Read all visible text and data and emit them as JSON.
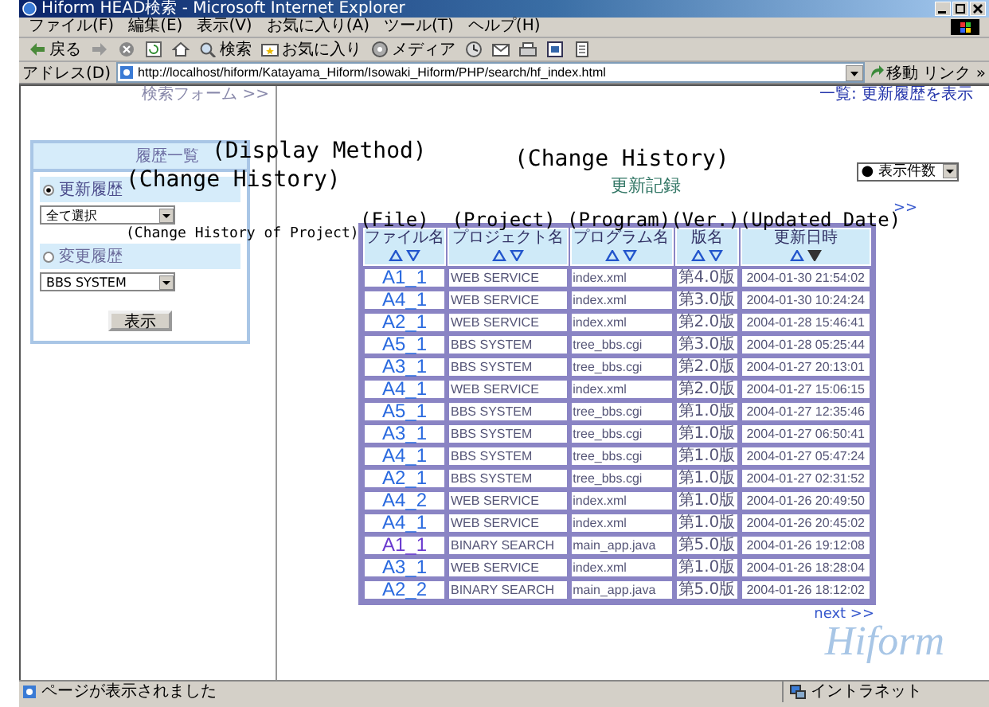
{
  "window": {
    "title": "Hiform HEAD検索 - Microsoft Internet Explorer"
  },
  "menu": [
    "ファイル(F)",
    "編集(E)",
    "表示(V)",
    "お気に入り(A)",
    "ツール(T)",
    "ヘルプ(H)"
  ],
  "toolbar": [
    {
      "kind": "back",
      "label": "戻る"
    },
    {
      "kind": "forward"
    },
    {
      "kind": "stop"
    },
    {
      "kind": "refresh"
    },
    {
      "kind": "home"
    },
    {
      "kind": "search",
      "label": "検索"
    },
    {
      "kind": "favorites",
      "label": "お気に入り"
    },
    {
      "kind": "media",
      "label": "メディア"
    },
    {
      "kind": "history"
    },
    {
      "kind": "mail"
    },
    {
      "kind": "print"
    },
    {
      "kind": "edit"
    },
    {
      "kind": "discuss"
    }
  ],
  "address": {
    "label": "アドレス(D)",
    "url": "http://localhost/hiform/Katayama_Hiform/Isowaki_Hiform/PHP/search/hf_index.html",
    "go": "移動",
    "links": "リンク »"
  },
  "left_frame": {
    "search_form_link": "検索フォーム >>",
    "panel_title": "履歴一覧",
    "options": [
      {
        "label": "更新履歴",
        "selected": true,
        "select": "全て選択"
      },
      {
        "label": "変更履歴",
        "selected": false,
        "select": "BBS SYSTEM"
      }
    ],
    "button": "表示"
  },
  "right_frame": {
    "top_link": "一覧:  更新履歴を表示",
    "heading": "更新記録",
    "count_select": "●  表示件数",
    "top_next": ">>",
    "table": {
      "columns": [
        {
          "label": "ファイル名",
          "sorted_desc": false
        },
        {
          "label": "プロジェクト名",
          "sorted_desc": false
        },
        {
          "label": "プログラム名",
          "sorted_desc": false
        },
        {
          "label": "版名",
          "sorted_desc": false
        },
        {
          "label": "更新日時",
          "sorted_desc": true
        }
      ],
      "rows": [
        {
          "file": "A1_1",
          "visited": false,
          "project": "WEB SERVICE",
          "program": "index.xml",
          "version": "第4.0版",
          "date": "2004-01-30 21:54:02"
        },
        {
          "file": "A4_1",
          "visited": false,
          "project": "WEB SERVICE",
          "program": "index.xml",
          "version": "第3.0版",
          "date": "2004-01-30 10:24:24"
        },
        {
          "file": "A2_1",
          "visited": false,
          "project": "WEB SERVICE",
          "program": "index.xml",
          "version": "第2.0版",
          "date": "2004-01-28 15:46:41"
        },
        {
          "file": "A5_1",
          "visited": false,
          "project": "BBS SYSTEM",
          "program": "tree_bbs.cgi",
          "version": "第3.0版",
          "date": "2004-01-28 05:25:44"
        },
        {
          "file": "A3_1",
          "visited": false,
          "project": "BBS SYSTEM",
          "program": "tree_bbs.cgi",
          "version": "第2.0版",
          "date": "2004-01-27 20:13:01"
        },
        {
          "file": "A4_1",
          "visited": false,
          "project": "WEB SERVICE",
          "program": "index.xml",
          "version": "第2.0版",
          "date": "2004-01-27 15:06:15"
        },
        {
          "file": "A5_1",
          "visited": false,
          "project": "BBS SYSTEM",
          "program": "tree_bbs.cgi",
          "version": "第1.0版",
          "date": "2004-01-27 12:35:46"
        },
        {
          "file": "A3_1",
          "visited": false,
          "project": "BBS SYSTEM",
          "program": "tree_bbs.cgi",
          "version": "第1.0版",
          "date": "2004-01-27 06:50:41"
        },
        {
          "file": "A4_1",
          "visited": false,
          "project": "BBS SYSTEM",
          "program": "tree_bbs.cgi",
          "version": "第1.0版",
          "date": "2004-01-27 05:47:24"
        },
        {
          "file": "A2_1",
          "visited": false,
          "project": "BBS SYSTEM",
          "program": "tree_bbs.cgi",
          "version": "第1.0版",
          "date": "2004-01-27 02:31:52"
        },
        {
          "file": "A4_2",
          "visited": false,
          "project": "WEB SERVICE",
          "program": "index.xml",
          "version": "第1.0版",
          "date": "2004-01-26 20:49:50"
        },
        {
          "file": "A4_1",
          "visited": false,
          "project": "WEB SERVICE",
          "program": "index.xml",
          "version": "第1.0版",
          "date": "2004-01-26 20:45:02"
        },
        {
          "file": "A1_1",
          "visited": true,
          "project": "BINARY SEARCH",
          "program": "main_app.java",
          "version": "第5.0版",
          "date": "2004-01-26 19:12:08"
        },
        {
          "file": "A3_1",
          "visited": false,
          "project": "WEB SERVICE",
          "program": "index.xml",
          "version": "第1.0版",
          "date": "2004-01-26 18:28:04"
        },
        {
          "file": "A2_2",
          "visited": false,
          "project": "BINARY SEARCH",
          "program": "main_app.java",
          "version": "第5.0版",
          "date": "2004-01-26 18:12:02"
        }
      ]
    },
    "next": "next >>",
    "logo": "Hiform"
  },
  "annotations": [
    {
      "kind": "display",
      "text": "(Display Method)"
    },
    {
      "kind": "option1",
      "text": "(Change History)"
    },
    {
      "kind": "option2",
      "text": "(Change History of Project)"
    },
    {
      "kind": "heading",
      "text": "(Change History)"
    },
    {
      "kind": "columns",
      "text": "(File)  (Project) (Program)(Ver.)(Updated Date)"
    }
  ],
  "status_bar": {
    "text": "ページが表示されました",
    "zone": "イントラネット"
  }
}
